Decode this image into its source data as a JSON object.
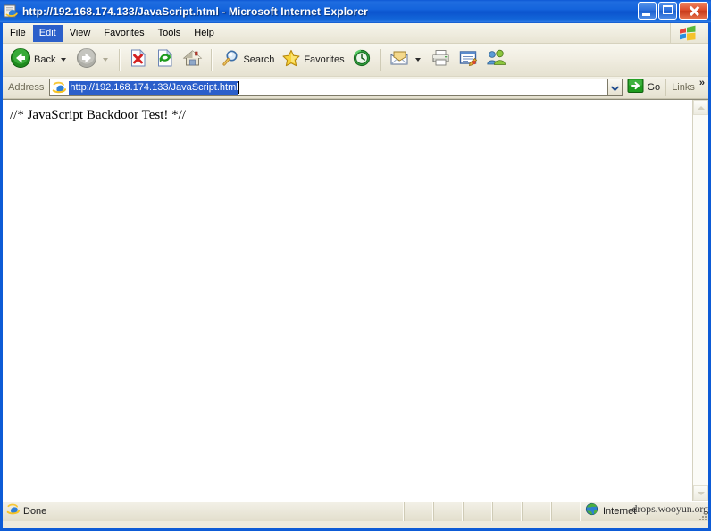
{
  "window": {
    "title": "http://192.168.174.133/JavaScript.html - Microsoft Internet Explorer",
    "icon": "internet-explorer-icon",
    "buttons": {
      "minimize": "Minimize",
      "maximize": "Maximize",
      "close": "Close"
    }
  },
  "menubar": {
    "items": [
      {
        "label": "File",
        "active": false
      },
      {
        "label": "Edit",
        "active": true
      },
      {
        "label": "View",
        "active": false
      },
      {
        "label": "Favorites",
        "active": false
      },
      {
        "label": "Tools",
        "active": false
      },
      {
        "label": "Help",
        "active": false
      }
    ],
    "brand_icon": "windows-flag-icon"
  },
  "toolbar": {
    "back_label": "Back",
    "forward_label": "",
    "search_label": "Search",
    "favorites_label": "Favorites",
    "icons": {
      "back": "back-arrow-icon",
      "forward": "forward-arrow-icon",
      "stop": "stop-icon",
      "refresh": "refresh-icon",
      "home": "home-icon",
      "search": "magnifier-icon",
      "favorites": "star-icon",
      "history": "history-clock-icon",
      "mail": "mail-icon",
      "print": "printer-icon",
      "edit": "edit-page-icon",
      "messenger": "messenger-people-icon"
    }
  },
  "address": {
    "label": "Address",
    "value": "http://192.168.174.133/JavaScript.html",
    "placeholder": "Address",
    "favicon": "internet-explorer-icon",
    "go_label": "Go",
    "links_label": "Links",
    "chevron": "»",
    "selected": true
  },
  "page": {
    "text": "//* JavaScript Backdoor Test! *//"
  },
  "scrollbar": {
    "up": "scroll-up-arrow-icon",
    "down": "scroll-down-arrow-icon",
    "enabled": false
  },
  "statusbar": {
    "status_text": "Done",
    "status_icon": "internet-explorer-icon",
    "zone_text": "Internet",
    "zone_icon": "globe-icon",
    "watermark": "drops.wooyun.org"
  },
  "colors": {
    "title_blue": "#1464DC",
    "frame_blue": "#0D5BD6",
    "menu_highlight": "#2B5FCA",
    "toolbar_bg": "#EDEADD",
    "selection_blue": "#2B5FCA",
    "go_green": "#1E9B1E",
    "stop_red": "#D82020"
  }
}
